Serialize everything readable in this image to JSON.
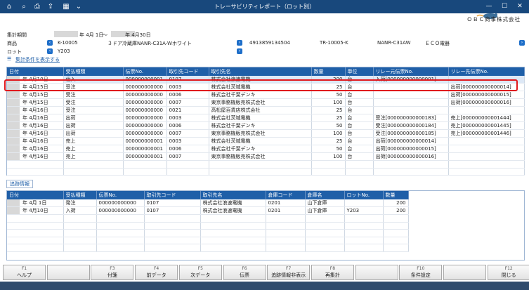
{
  "window": {
    "title": "トレーサビリティレポート（ロット別）",
    "company": "ＯＢＣ商事株式会社",
    "controls": {
      "minimize": "—",
      "maximize": "☐",
      "close": "✕"
    }
  },
  "toolbar_icons": [
    "home-icon",
    "search-icon",
    "print-icon",
    "excel-icon",
    "chevron-down-icon"
  ],
  "header": {
    "period_label": "集計期間",
    "period_from": "年  4月  1日",
    "period_sep": "～",
    "period_to": "年  4月30日",
    "product_label": "商品",
    "product_code": "K-10005",
    "product_name": "３ドア冷蔵庫NANR-C31A-Wホワイト",
    "jan_code": "4913859134504",
    "model_no": "TR-10005-K",
    "model_name": "NANR-C31AW",
    "maker": "ＥＣＯ電器",
    "lot_label": "ロット",
    "lot_value": "Y203",
    "show_conditions": "集計条件を表示する"
  },
  "main_grid": {
    "columns": [
      "日付",
      "受払種類",
      "伝票No.",
      "取引先コード",
      "取引先名",
      "数量",
      "単位",
      "リレー元伝票No.",
      "リレー先伝票No."
    ],
    "rows": [
      {
        "date": "年  4月10日",
        "type": "仕入",
        "slip": "000000000001",
        "code": "0107",
        "name": "株式会社浪速電機",
        "qty": "200",
        "unit": "台",
        "from": "入荷[000000000000001]",
        "to": ""
      },
      {
        "date": "年  4月15日",
        "type": "受注",
        "slip": "000000000000",
        "code": "0003",
        "name": "株式会社茨城電機",
        "qty": "25",
        "unit": "台",
        "from": "",
        "to": "出荷[000000000000014]"
      },
      {
        "date": "年  4月15日",
        "type": "受注",
        "slip": "000000000000",
        "code": "0006",
        "name": "株式会社千葉デンキ",
        "qty": "50",
        "unit": "台",
        "from": "",
        "to": "出荷[000000000000015]"
      },
      {
        "date": "年  4月15日",
        "type": "受注",
        "slip": "000000000000",
        "code": "0007",
        "name": "東京事務機販売株式会社",
        "qty": "100",
        "unit": "台",
        "from": "",
        "to": "出荷[000000000000016]"
      },
      {
        "date": "年  4月16日",
        "type": "受注",
        "slip": "000000000000",
        "code": "0021",
        "name": "高松屋百貨店株式会社",
        "qty": "25",
        "unit": "台",
        "from": "",
        "to": ""
      },
      {
        "date": "年  4月16日",
        "type": "出荷",
        "slip": "000000000000",
        "code": "0003",
        "name": "株式会社茨城電機",
        "qty": "25",
        "unit": "台",
        "from": "受注[000000000000183]",
        "to": "売上[000000000001444]"
      },
      {
        "date": "年  4月16日",
        "type": "出荷",
        "slip": "000000000000",
        "code": "0006",
        "name": "株式会社千葉デンキ",
        "qty": "50",
        "unit": "台",
        "from": "受注[000000000000184]",
        "to": "売上[000000000001445]"
      },
      {
        "date": "年  4月16日",
        "type": "出荷",
        "slip": "000000000000",
        "code": "0007",
        "name": "東京事務機販売株式会社",
        "qty": "100",
        "unit": "台",
        "from": "受注[000000000000185]",
        "to": "売上[000000000001446]"
      },
      {
        "date": "年  4月16日",
        "type": "売上",
        "slip": "000000000001",
        "code": "0003",
        "name": "株式会社茨城電機",
        "qty": "25",
        "unit": "台",
        "from": "出荷[000000000000014]",
        "to": ""
      },
      {
        "date": "年  4月16日",
        "type": "売上",
        "slip": "000000000001",
        "code": "0006",
        "name": "株式会社千葉デンキ",
        "qty": "50",
        "unit": "台",
        "from": "出荷[000000000000015]",
        "to": ""
      },
      {
        "date": "年  4月16日",
        "type": "売上",
        "slip": "000000000001",
        "code": "0007",
        "name": "東京事務機販売株式会社",
        "qty": "100",
        "unit": "台",
        "from": "出荷[000000000000016]",
        "to": ""
      }
    ]
  },
  "trace_tab": "追跡情報",
  "trace_grid": {
    "columns": [
      "日付",
      "受払種類",
      "伝票No.",
      "取引先コード",
      "取引先名",
      "倉庫コード",
      "倉庫名",
      "ロットNo.",
      "数量"
    ],
    "rows": [
      {
        "date": "年  4月  1日",
        "type": "発注",
        "slip": "000000000000",
        "code": "0107",
        "name": "株式会社浪速電機",
        "wh": "0201",
        "whname": "山下倉庫",
        "lot": "",
        "qty": "200"
      },
      {
        "date": "年  4月10日",
        "type": "入荷",
        "slip": "000000000000",
        "code": "0107",
        "name": "株式会社浪速電機",
        "wh": "0201",
        "whname": "山下倉庫",
        "lot": "Y203",
        "qty": "200"
      }
    ]
  },
  "fkeys": [
    {
      "key": "F1",
      "label": "ヘルプ"
    },
    {
      "key": "",
      "label": ""
    },
    {
      "key": "F3",
      "label": "付箋"
    },
    {
      "key": "F4",
      "label": "前データ"
    },
    {
      "key": "F5",
      "label": "次データ"
    },
    {
      "key": "F6",
      "label": "伝票"
    },
    {
      "key": "F7",
      "label": "追跡情報非表示"
    },
    {
      "key": "F8",
      "label": "再集計"
    },
    {
      "key": "",
      "label": ""
    },
    {
      "key": "F10",
      "label": "条件設定"
    },
    {
      "key": "",
      "label": ""
    },
    {
      "key": "F12",
      "label": "閉じる"
    }
  ]
}
